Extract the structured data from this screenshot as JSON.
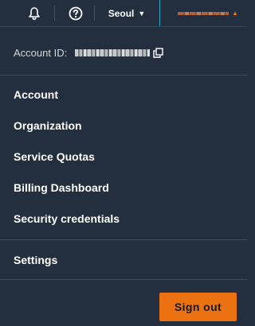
{
  "topbar": {
    "region_label": "Seoul",
    "icons": {
      "notifications": "bell-icon",
      "help": "help-circle-icon",
      "region_caret": "caret-down-icon",
      "account_caret": "caret-up-icon"
    }
  },
  "account_panel": {
    "account_id_label": "Account ID:",
    "copy_icon": "copy-icon",
    "menu_items": [
      {
        "label": "Account"
      },
      {
        "label": "Organization"
      },
      {
        "label": "Service Quotas"
      },
      {
        "label": "Billing Dashboard"
      },
      {
        "label": "Security credentials"
      }
    ],
    "settings_label": "Settings",
    "sign_out_label": "Sign out"
  },
  "colors": {
    "background": "#232f3e",
    "accent": "#ec7211",
    "divider": "#3f4b5b",
    "text": "#ffffff",
    "muted_text": "#d5dbdb"
  }
}
